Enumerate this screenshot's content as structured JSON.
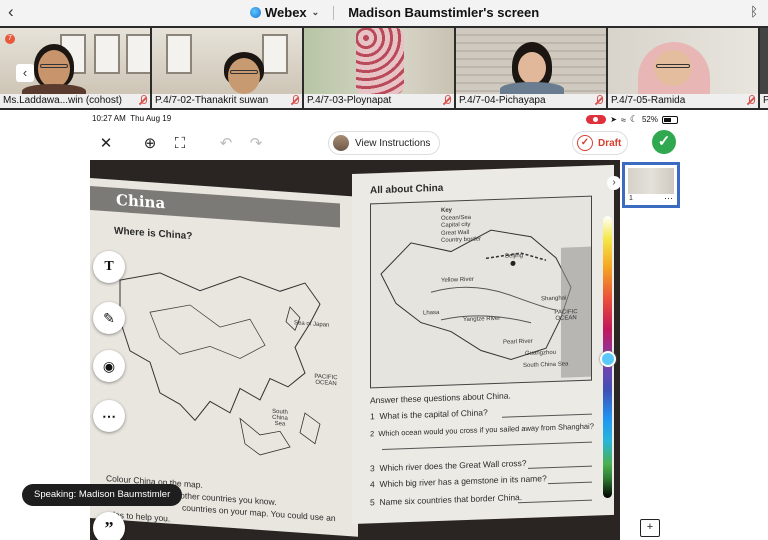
{
  "webex": {
    "app_label": "Webex",
    "screen_title": "Madison Baumstimler's screen",
    "notification_count": "7"
  },
  "participants": [
    {
      "name": "Ms.Laddawa...win (cohost)"
    },
    {
      "name": "P.4/7-02-Thanakrit suwan"
    },
    {
      "name": "P.4/7-03-Ploynapat"
    },
    {
      "name": "P.4/7-04-Pichayapa"
    },
    {
      "name": "P.4/7-05-Ramida"
    },
    {
      "name": "P"
    }
  ],
  "ipad_status": {
    "time": "10:27 AM",
    "date": "Thu Aug 19",
    "battery": "52%"
  },
  "toolbar": {
    "view_instructions": "View Instructions",
    "draft": "Draft"
  },
  "workbook": {
    "left_title": "China",
    "left_question": "Where is China?",
    "left_map_labels": [
      "Sea of Japan",
      "PACIFIC OCEAN",
      "South China Sea"
    ],
    "left_instructions": [
      "Colour China on the map.",
      "Colour some of the other countries you know.",
      "countries on your map. You could use an",
      "atlas to help you."
    ],
    "right_title": "All about China",
    "key": [
      "Key",
      "Ocean/Sea",
      "Capital city",
      "Great Wall",
      "Country border"
    ],
    "right_map_labels": [
      "Beijing",
      "Yellow River",
      "Lhasa",
      "Yangtze River",
      "Shanghai",
      "PACIFIC OCEAN",
      "Pearl River",
      "Guangzhou",
      "South China Sea"
    ],
    "answer_prompt": "Answer these questions about China.",
    "questions": [
      {
        "num": "1",
        "text": "What is the capital of China?"
      },
      {
        "num": "2",
        "text": "Which ocean would you cross if you sailed away from Shanghai?"
      },
      {
        "num": "3",
        "text": "Which river does the Great Wall cross?"
      },
      {
        "num": "4",
        "text": "Which big river has a gemstone in its name?"
      },
      {
        "num": "5",
        "text": "Name six countries that border China."
      }
    ]
  },
  "thumbnail": {
    "page_number": "1"
  },
  "speaking": "Speaking: Madison Baumstimler",
  "colors": {
    "draft_red": "#d6402e",
    "done_green": "#2fa84f",
    "thumb_blue": "#3b6cc2",
    "record_red": "#e0303b"
  }
}
